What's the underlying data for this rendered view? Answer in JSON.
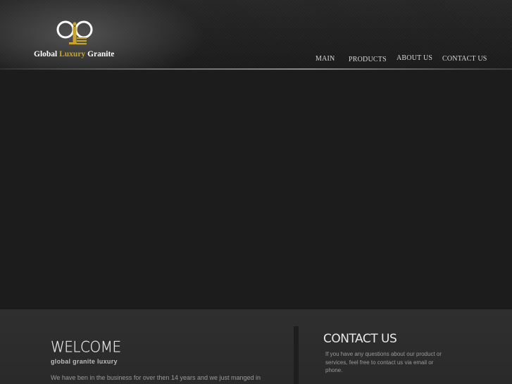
{
  "header": {
    "logo": {
      "brand_first": "Global",
      "brand_accent": "Luxury",
      "brand_last": "Granite",
      "accent_color": "#c9a22a"
    },
    "nav": [
      {
        "label": "MAIN"
      },
      {
        "label": "PRODUCTS"
      },
      {
        "label": "ABOUT US"
      },
      {
        "label": "CONTACT US"
      }
    ]
  },
  "welcome": {
    "title": "WELCOME",
    "subtitle": "global granite luxury",
    "body": "We have ben in the business for over then 14 years and we just manged in"
  },
  "contact": {
    "title": "CONTACT US",
    "body": "If you have any questions about our product or services, feel free to contact us via email or phone."
  }
}
